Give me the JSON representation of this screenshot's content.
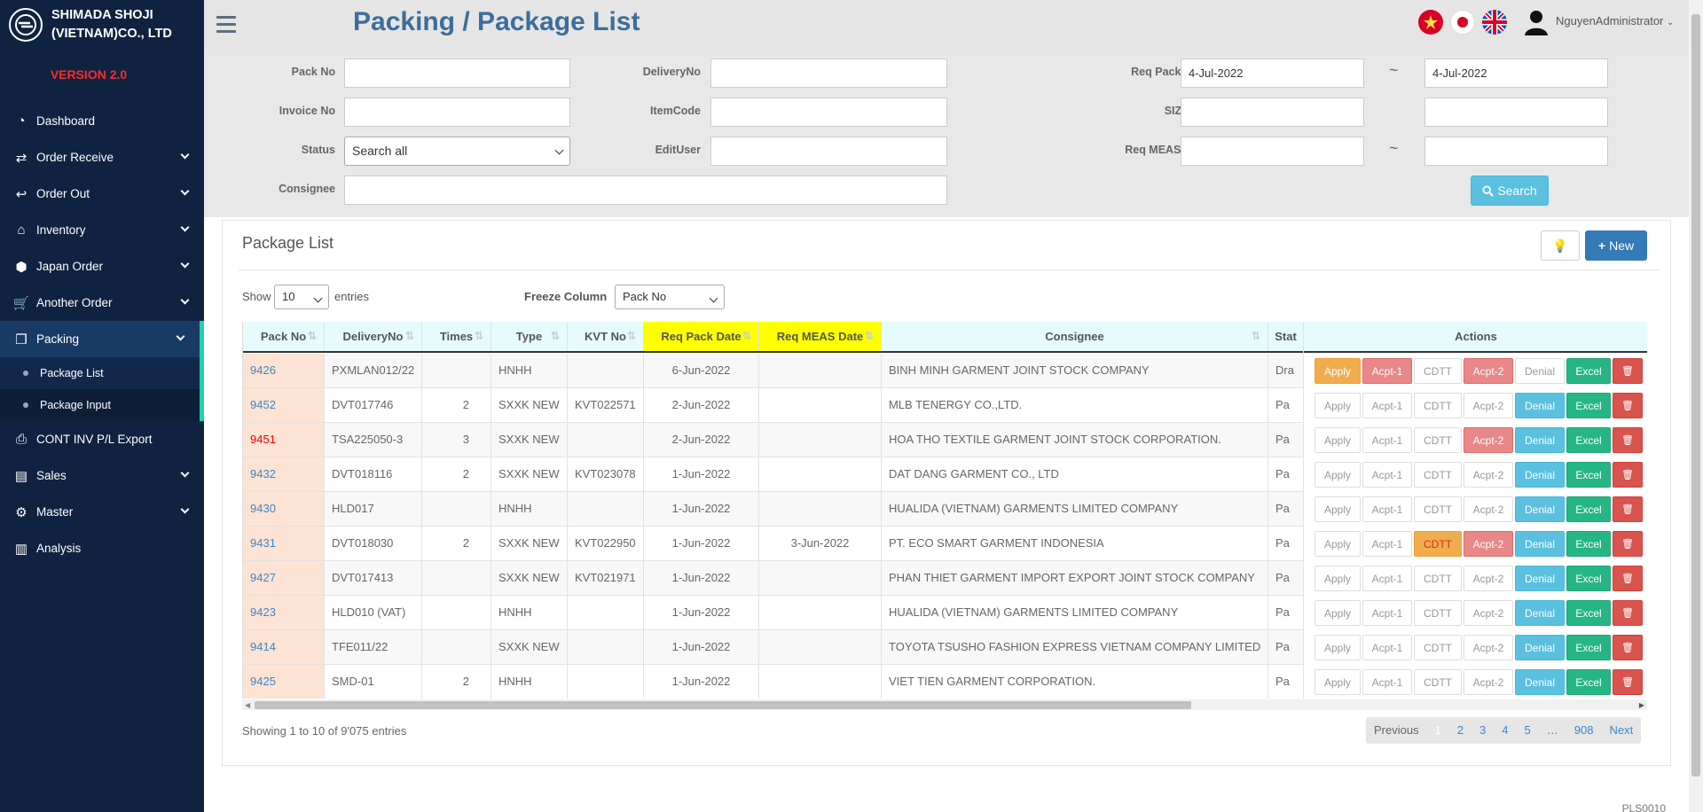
{
  "sidebar": {
    "brand_line1": "SHIMADA SHOJI",
    "brand_line2": "(VIETNAM)CO., LTD",
    "version": "VERSION 2.0",
    "items": [
      {
        "label": "Dashboard",
        "icon": "dashboard-icon",
        "glyph": "◔"
      },
      {
        "label": "Order Receive",
        "icon": "shuffle-icon",
        "glyph": "⇄"
      },
      {
        "label": "Order Out",
        "icon": "reply-icon",
        "glyph": "↩"
      },
      {
        "label": "Inventory",
        "icon": "home-icon",
        "glyph": "⌂"
      },
      {
        "label": "Japan Order",
        "icon": "cube-icon",
        "glyph": "⬢"
      },
      {
        "label": "Another Order",
        "icon": "cart-icon",
        "glyph": "🛒"
      },
      {
        "label": "Packing",
        "icon": "cubes-icon",
        "glyph": "❒"
      },
      {
        "label": "CONT INV P/L Export",
        "icon": "print-icon",
        "glyph": "⎙"
      },
      {
        "label": "Sales",
        "icon": "newspaper-icon",
        "glyph": "▤"
      },
      {
        "label": "Master",
        "icon": "cogs-icon",
        "glyph": "⚙"
      },
      {
        "label": "Analysis",
        "icon": "bar-chart-icon",
        "glyph": "▥"
      }
    ],
    "subitems": [
      "Package List",
      "Package Input"
    ]
  },
  "header": {
    "title": "Packing / Package List",
    "user": "NguyenAdministrator"
  },
  "filters": {
    "pack_no_label": "Pack No",
    "invoice_no_label": "Invoice No",
    "status_label": "Status",
    "status_value": "Search all",
    "consignee_label": "Consignee",
    "delivery_no_label": "DeliveryNo",
    "item_code_label": "ItemCode",
    "edit_user_label": "EditUser",
    "req_pack_date_label": "Req Pack Date",
    "req_pack_date_from": "4-Jul-2022",
    "req_pack_date_to": "4-Jul-2022",
    "siz_col_label": "SIZ.COL",
    "req_meas_date_label": "Req MEAS Date",
    "tilde": "~",
    "search_label": "Search"
  },
  "panel": {
    "title": "Package List",
    "new_label": "New",
    "show_label": "Show",
    "entries_value": "10",
    "entries_label": "entries",
    "freeze_label": "Freeze Column",
    "freeze_value": "Pack No"
  },
  "table": {
    "columns": [
      "Pack No",
      "DeliveryNo",
      "Times",
      "Type",
      "KVT No",
      "Req Pack Date",
      "Req MEAS Date",
      "Consignee",
      "Stat"
    ],
    "actions_header": "Actions",
    "rows": [
      {
        "pack_no": "9426",
        "delivery_no": "PXMLAN012/22",
        "times": "",
        "type": "HNHH",
        "kvt_no": "",
        "req_pack_date": "6-Jun-2022",
        "req_meas_date": "",
        "consignee": "BINH MINH GARMENT JOINT STOCK COMPANY",
        "status": "Dra"
      },
      {
        "pack_no": "9452",
        "delivery_no": "DVT017746",
        "times": "2",
        "type": "SXXK NEW",
        "kvt_no": "KVT022571",
        "req_pack_date": "2-Jun-2022",
        "req_meas_date": "",
        "consignee": "MLB TENERGY CO.,LTD.",
        "status": "Pa"
      },
      {
        "pack_no": "9451",
        "delivery_no": "TSA225050-3",
        "times": "3",
        "type": "SXXK NEW",
        "kvt_no": "",
        "req_pack_date": "2-Jun-2022",
        "req_meas_date": "",
        "consignee": "HOA THO TEXTILE GARMENT JOINT STOCK CORPORATION.",
        "status": "Pa"
      },
      {
        "pack_no": "9432",
        "delivery_no": "DVT018116",
        "times": "2",
        "type": "SXXK NEW",
        "kvt_no": "KVT023078",
        "req_pack_date": "1-Jun-2022",
        "req_meas_date": "",
        "consignee": "DAT DANG GARMENT CO., LTD",
        "status": "Pa"
      },
      {
        "pack_no": "9430",
        "delivery_no": "HLD017",
        "times": "",
        "type": "HNHH",
        "kvt_no": "",
        "req_pack_date": "1-Jun-2022",
        "req_meas_date": "",
        "consignee": "HUALIDA (VIETNAM) GARMENTS LIMITED COMPANY",
        "status": "Pa"
      },
      {
        "pack_no": "9431",
        "delivery_no": "DVT018030",
        "times": "2",
        "type": "SXXK NEW",
        "kvt_no": "KVT022950",
        "req_pack_date": "1-Jun-2022",
        "req_meas_date": "3-Jun-2022",
        "consignee": "PT. ECO SMART GARMENT INDONESIA",
        "status": "Pa"
      },
      {
        "pack_no": "9427",
        "delivery_no": "DVT017413",
        "times": "",
        "type": "SXXK NEW",
        "kvt_no": "KVT021971",
        "req_pack_date": "1-Jun-2022",
        "req_meas_date": "",
        "consignee": "PHAN THIET GARMENT IMPORT EXPORT JOINT STOCK COMPANY",
        "status": "Pa"
      },
      {
        "pack_no": "9423",
        "delivery_no": "HLD010 (VAT)",
        "times": "",
        "type": "HNHH",
        "kvt_no": "",
        "req_pack_date": "1-Jun-2022",
        "req_meas_date": "",
        "consignee": "HUALIDA (VIETNAM) GARMENTS LIMITED COMPANY",
        "status": "Pa"
      },
      {
        "pack_no": "9414",
        "delivery_no": "TFE011/22",
        "times": "",
        "type": "SXXK NEW",
        "kvt_no": "",
        "req_pack_date": "1-Jun-2022",
        "req_meas_date": "",
        "consignee": "TOYOTA TSUSHO FASHION EXPRESS VIETNAM COMPANY LIMITED",
        "status": "Pa"
      },
      {
        "pack_no": "9425",
        "delivery_no": "SMD-01",
        "times": "2",
        "type": "HNHH",
        "kvt_no": "",
        "req_pack_date": "1-Jun-2022",
        "req_meas_date": "",
        "consignee": "VIET TIEN GARMENT CORPORATION.",
        "status": "Pa"
      }
    ],
    "action_labels": {
      "apply": "Apply",
      "acpt1": "Acpt-1",
      "cdtt": "CDTT",
      "acpt2": "Acpt-2",
      "denial": "Denial",
      "excel": "Excel"
    },
    "action_states": [
      {
        "apply": "orange",
        "acpt1": "pink",
        "cdtt": "plain",
        "acpt2": "pink",
        "denial": "plain"
      },
      {
        "apply": "plain",
        "acpt1": "plain",
        "cdtt": "plain",
        "acpt2": "plain",
        "denial": "info"
      },
      {
        "apply": "plain",
        "acpt1": "plain",
        "cdtt": "plain",
        "acpt2": "pink",
        "denial": "info"
      },
      {
        "apply": "plain",
        "acpt1": "plain",
        "cdtt": "plain",
        "acpt2": "plain",
        "denial": "info"
      },
      {
        "apply": "plain",
        "acpt1": "plain",
        "cdtt": "plain",
        "acpt2": "plain",
        "denial": "info"
      },
      {
        "apply": "plain",
        "acpt1": "plain",
        "cdtt": "cdtt-on",
        "acpt2": "pink",
        "denial": "info"
      },
      {
        "apply": "plain",
        "acpt1": "plain",
        "cdtt": "plain",
        "acpt2": "plain",
        "denial": "info"
      },
      {
        "apply": "plain",
        "acpt1": "plain",
        "cdtt": "plain",
        "acpt2": "plain",
        "denial": "info"
      },
      {
        "apply": "plain",
        "acpt1": "plain",
        "cdtt": "plain",
        "acpt2": "plain",
        "denial": "info"
      },
      {
        "apply": "plain",
        "acpt1": "plain",
        "cdtt": "plain",
        "acpt2": "plain",
        "denial": "info"
      }
    ]
  },
  "pagination": {
    "info": "Showing 1 to 10 of 9'075 entries",
    "previous": "Previous",
    "pages": [
      "1",
      "2",
      "3",
      "4",
      "5",
      "…",
      "908"
    ],
    "next": "Next"
  },
  "footer": {
    "code": "PLS0010"
  },
  "colors": {
    "sidebar_bg": "#0f2340",
    "title": "#3c6e9c",
    "accent": "#1fd3a6",
    "version_red": "#ff2a2a",
    "header_highlight": "#ffff00"
  }
}
